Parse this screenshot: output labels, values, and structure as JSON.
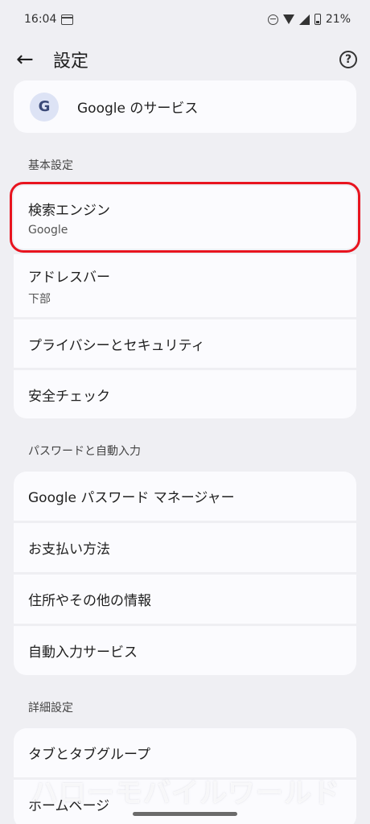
{
  "status_bar": {
    "time": "16:04",
    "battery": "21%"
  },
  "app_bar": {
    "back_icon": "←",
    "title": "設定",
    "help_icon": "?"
  },
  "google_service": {
    "logo": "G",
    "label": "Google のサービス"
  },
  "sections": {
    "basic": {
      "header": "基本設定",
      "items": {
        "search_engine": {
          "label": "検索エンジン",
          "sub": "Google"
        },
        "address_bar": {
          "label": "アドレスバー",
          "sub": "下部"
        },
        "privacy": {
          "label": "プライバシーとセキュリティ"
        },
        "safety_check": {
          "label": "安全チェック"
        }
      }
    },
    "autofill": {
      "header": "パスワードと自動入力",
      "items": {
        "password_manager": {
          "label": "Google パスワード マネージャー"
        },
        "payment": {
          "label": "お支払い方法"
        },
        "addresses": {
          "label": "住所やその他の情報"
        },
        "autofill_service": {
          "label": "自動入力サービス"
        }
      }
    },
    "advanced": {
      "header": "詳細設定",
      "items": {
        "tabs": {
          "label": "タブとタブグループ"
        },
        "homepage": {
          "label": "ホームページ"
        }
      }
    }
  },
  "watermark": "ハローモバイルワールド",
  "colors": {
    "highlight": "#e8141f",
    "background": "#efeff3",
    "card": "#fbfbfe"
  }
}
